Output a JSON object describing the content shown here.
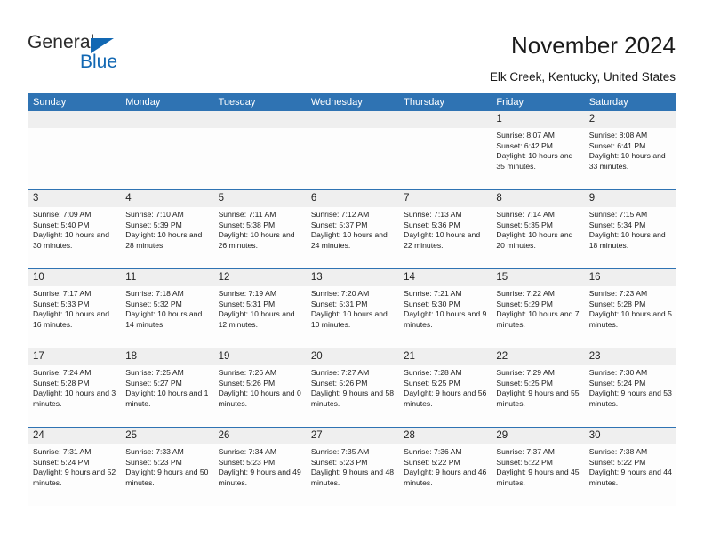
{
  "brand": {
    "name_top": "General",
    "name_bottom": "Blue",
    "accent_color": "#1268b3"
  },
  "header": {
    "title": "November 2024",
    "subtitle": "Elk Creek, Kentucky, United States"
  },
  "calendar": {
    "header_color": "#2f73b3",
    "weekdays": [
      "Sunday",
      "Monday",
      "Tuesday",
      "Wednesday",
      "Thursday",
      "Friday",
      "Saturday"
    ],
    "weeks": [
      [
        {
          "day": "",
          "sunrise": "",
          "sunset": "",
          "daylight": "",
          "empty": true
        },
        {
          "day": "",
          "sunrise": "",
          "sunset": "",
          "daylight": "",
          "empty": true
        },
        {
          "day": "",
          "sunrise": "",
          "sunset": "",
          "daylight": "",
          "empty": true
        },
        {
          "day": "",
          "sunrise": "",
          "sunset": "",
          "daylight": "",
          "empty": true
        },
        {
          "day": "",
          "sunrise": "",
          "sunset": "",
          "daylight": "",
          "empty": true
        },
        {
          "day": "1",
          "sunrise": "Sunrise: 8:07 AM",
          "sunset": "Sunset: 6:42 PM",
          "daylight": "Daylight: 10 hours and 35 minutes."
        },
        {
          "day": "2",
          "sunrise": "Sunrise: 8:08 AM",
          "sunset": "Sunset: 6:41 PM",
          "daylight": "Daylight: 10 hours and 33 minutes."
        }
      ],
      [
        {
          "day": "3",
          "sunrise": "Sunrise: 7:09 AM",
          "sunset": "Sunset: 5:40 PM",
          "daylight": "Daylight: 10 hours and 30 minutes."
        },
        {
          "day": "4",
          "sunrise": "Sunrise: 7:10 AM",
          "sunset": "Sunset: 5:39 PM",
          "daylight": "Daylight: 10 hours and 28 minutes."
        },
        {
          "day": "5",
          "sunrise": "Sunrise: 7:11 AM",
          "sunset": "Sunset: 5:38 PM",
          "daylight": "Daylight: 10 hours and 26 minutes."
        },
        {
          "day": "6",
          "sunrise": "Sunrise: 7:12 AM",
          "sunset": "Sunset: 5:37 PM",
          "daylight": "Daylight: 10 hours and 24 minutes."
        },
        {
          "day": "7",
          "sunrise": "Sunrise: 7:13 AM",
          "sunset": "Sunset: 5:36 PM",
          "daylight": "Daylight: 10 hours and 22 minutes."
        },
        {
          "day": "8",
          "sunrise": "Sunrise: 7:14 AM",
          "sunset": "Sunset: 5:35 PM",
          "daylight": "Daylight: 10 hours and 20 minutes."
        },
        {
          "day": "9",
          "sunrise": "Sunrise: 7:15 AM",
          "sunset": "Sunset: 5:34 PM",
          "daylight": "Daylight: 10 hours and 18 minutes."
        }
      ],
      [
        {
          "day": "10",
          "sunrise": "Sunrise: 7:17 AM",
          "sunset": "Sunset: 5:33 PM",
          "daylight": "Daylight: 10 hours and 16 minutes."
        },
        {
          "day": "11",
          "sunrise": "Sunrise: 7:18 AM",
          "sunset": "Sunset: 5:32 PM",
          "daylight": "Daylight: 10 hours and 14 minutes."
        },
        {
          "day": "12",
          "sunrise": "Sunrise: 7:19 AM",
          "sunset": "Sunset: 5:31 PM",
          "daylight": "Daylight: 10 hours and 12 minutes."
        },
        {
          "day": "13",
          "sunrise": "Sunrise: 7:20 AM",
          "sunset": "Sunset: 5:31 PM",
          "daylight": "Daylight: 10 hours and 10 minutes."
        },
        {
          "day": "14",
          "sunrise": "Sunrise: 7:21 AM",
          "sunset": "Sunset: 5:30 PM",
          "daylight": "Daylight: 10 hours and 9 minutes."
        },
        {
          "day": "15",
          "sunrise": "Sunrise: 7:22 AM",
          "sunset": "Sunset: 5:29 PM",
          "daylight": "Daylight: 10 hours and 7 minutes."
        },
        {
          "day": "16",
          "sunrise": "Sunrise: 7:23 AM",
          "sunset": "Sunset: 5:28 PM",
          "daylight": "Daylight: 10 hours and 5 minutes."
        }
      ],
      [
        {
          "day": "17",
          "sunrise": "Sunrise: 7:24 AM",
          "sunset": "Sunset: 5:28 PM",
          "daylight": "Daylight: 10 hours and 3 minutes."
        },
        {
          "day": "18",
          "sunrise": "Sunrise: 7:25 AM",
          "sunset": "Sunset: 5:27 PM",
          "daylight": "Daylight: 10 hours and 1 minute."
        },
        {
          "day": "19",
          "sunrise": "Sunrise: 7:26 AM",
          "sunset": "Sunset: 5:26 PM",
          "daylight": "Daylight: 10 hours and 0 minutes."
        },
        {
          "day": "20",
          "sunrise": "Sunrise: 7:27 AM",
          "sunset": "Sunset: 5:26 PM",
          "daylight": "Daylight: 9 hours and 58 minutes."
        },
        {
          "day": "21",
          "sunrise": "Sunrise: 7:28 AM",
          "sunset": "Sunset: 5:25 PM",
          "daylight": "Daylight: 9 hours and 56 minutes."
        },
        {
          "day": "22",
          "sunrise": "Sunrise: 7:29 AM",
          "sunset": "Sunset: 5:25 PM",
          "daylight": "Daylight: 9 hours and 55 minutes."
        },
        {
          "day": "23",
          "sunrise": "Sunrise: 7:30 AM",
          "sunset": "Sunset: 5:24 PM",
          "daylight": "Daylight: 9 hours and 53 minutes."
        }
      ],
      [
        {
          "day": "24",
          "sunrise": "Sunrise: 7:31 AM",
          "sunset": "Sunset: 5:24 PM",
          "daylight": "Daylight: 9 hours and 52 minutes."
        },
        {
          "day": "25",
          "sunrise": "Sunrise: 7:33 AM",
          "sunset": "Sunset: 5:23 PM",
          "daylight": "Daylight: 9 hours and 50 minutes."
        },
        {
          "day": "26",
          "sunrise": "Sunrise: 7:34 AM",
          "sunset": "Sunset: 5:23 PM",
          "daylight": "Daylight: 9 hours and 49 minutes."
        },
        {
          "day": "27",
          "sunrise": "Sunrise: 7:35 AM",
          "sunset": "Sunset: 5:23 PM",
          "daylight": "Daylight: 9 hours and 48 minutes."
        },
        {
          "day": "28",
          "sunrise": "Sunrise: 7:36 AM",
          "sunset": "Sunset: 5:22 PM",
          "daylight": "Daylight: 9 hours and 46 minutes."
        },
        {
          "day": "29",
          "sunrise": "Sunrise: 7:37 AM",
          "sunset": "Sunset: 5:22 PM",
          "daylight": "Daylight: 9 hours and 45 minutes."
        },
        {
          "day": "30",
          "sunrise": "Sunrise: 7:38 AM",
          "sunset": "Sunset: 5:22 PM",
          "daylight": "Daylight: 9 hours and 44 minutes."
        }
      ]
    ]
  }
}
